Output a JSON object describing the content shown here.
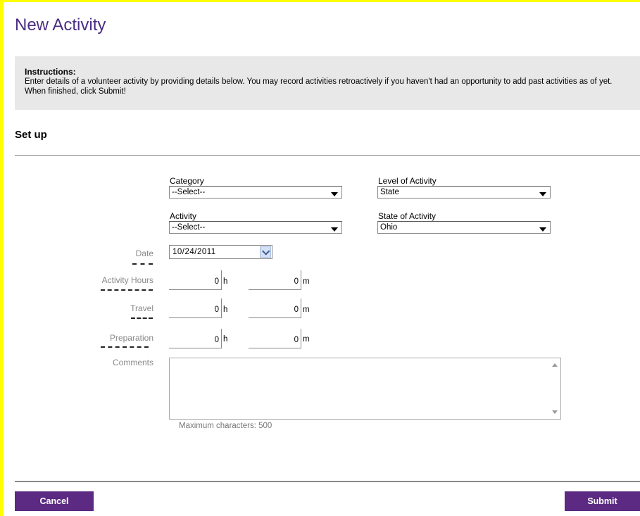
{
  "page": {
    "title": "New Activity"
  },
  "instructions": {
    "heading": "Instructions:",
    "text": "Enter details of a volunteer activity by providing details below. You may record activities retroactively if you haven't had an opportunity to add past activities as of yet. When finished, click Submit!"
  },
  "section": {
    "title": "Set up"
  },
  "form": {
    "category": {
      "label": "Category",
      "value": "--Select--"
    },
    "activity": {
      "label": "Activity",
      "value": "--Select--"
    },
    "level": {
      "label": "Level of Activity",
      "value": "State"
    },
    "state": {
      "label": "State of Activity",
      "value": "Ohio"
    },
    "date": {
      "label": "Date",
      "value": "10/24/2011"
    },
    "activity_hours": {
      "label": "Activity Hours",
      "hours": "0",
      "minutes": "0"
    },
    "travel": {
      "label": "Travel",
      "hours": "0",
      "minutes": "0"
    },
    "preparation": {
      "label": "Preparation",
      "hours": "0",
      "minutes": "0"
    },
    "units": {
      "hours": "h",
      "minutes": "m"
    },
    "comments": {
      "label": "Comments",
      "value": "",
      "max_note": "Maximum characters: 500"
    }
  },
  "buttons": {
    "cancel": "Cancel",
    "submit": "Submit"
  },
  "colors": {
    "brand": "#5c2a82",
    "title": "#4b2e83",
    "frame": "#ffff00",
    "panel": "#e8e8e8"
  },
  "icons": {
    "dropdown": "caret-down-icon",
    "date_picker": "chevron-down-icon",
    "scroll_up": "arrow-up-icon",
    "scroll_down": "arrow-down-icon"
  }
}
